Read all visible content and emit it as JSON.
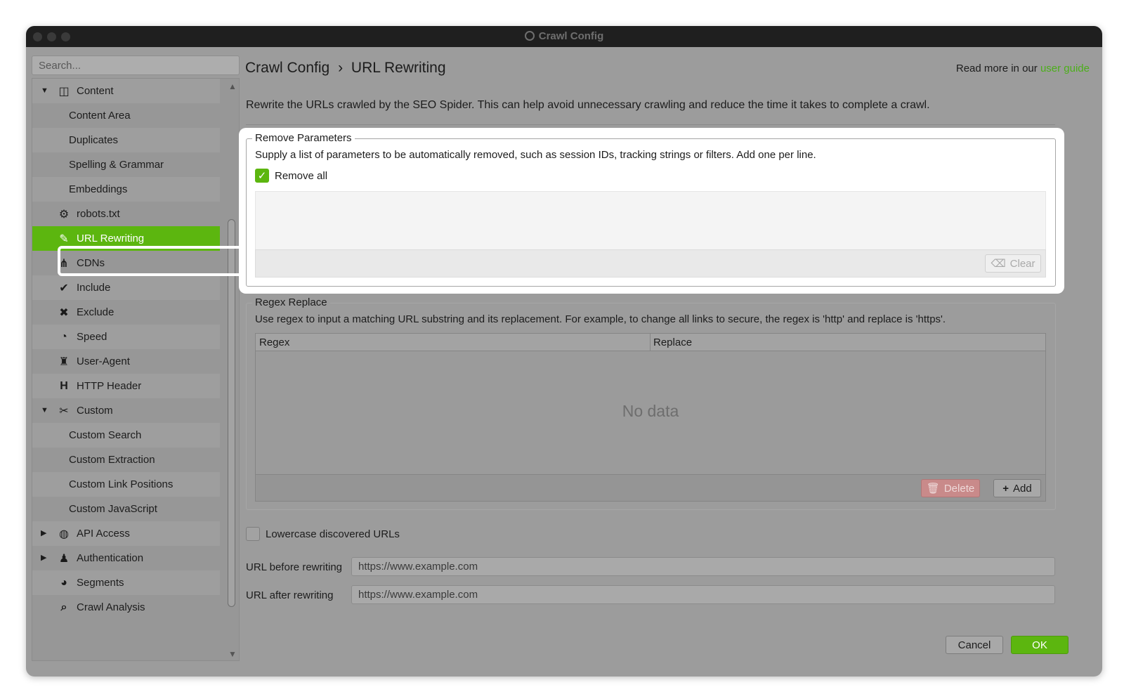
{
  "window": {
    "title": "Crawl Config"
  },
  "sidebar": {
    "search_placeholder": "Search...",
    "items": [
      {
        "label": "Content",
        "icon": "columns-icon",
        "level": 1,
        "arrow": "▼"
      },
      {
        "label": "Content Area",
        "level": 2
      },
      {
        "label": "Duplicates",
        "level": 2
      },
      {
        "label": "Spelling & Grammar",
        "level": 2
      },
      {
        "label": "Embeddings",
        "level": 2
      },
      {
        "label": "robots.txt",
        "icon": "robot-icon",
        "level": 1
      },
      {
        "label": "URL Rewriting",
        "icon": "edit-icon",
        "level": 1,
        "selected": true
      },
      {
        "label": "CDNs",
        "icon": "network-icon",
        "level": 1
      },
      {
        "label": "Include",
        "icon": "check-circle-icon",
        "level": 1
      },
      {
        "label": "Exclude",
        "icon": "x-circle-icon",
        "level": 1
      },
      {
        "label": "Speed",
        "icon": "gauge-icon",
        "level": 1
      },
      {
        "label": "User-Agent",
        "icon": "user-secret-icon",
        "level": 1
      },
      {
        "label": "HTTP Header",
        "icon": "heading-icon",
        "level": 1
      },
      {
        "label": "Custom",
        "icon": "tools-icon",
        "level": 1,
        "arrow": "▼"
      },
      {
        "label": "Custom Search",
        "level": 2
      },
      {
        "label": "Custom Extraction",
        "level": 2
      },
      {
        "label": "Custom Link Positions",
        "level": 2
      },
      {
        "label": "Custom JavaScript",
        "level": 2
      },
      {
        "label": "API Access",
        "icon": "globe-icon",
        "level": 1,
        "arrow": "▶"
      },
      {
        "label": "Authentication",
        "icon": "user-lock-icon",
        "level": 1,
        "arrow": "▶"
      },
      {
        "label": "Segments",
        "icon": "pie-chart-icon",
        "level": 1
      },
      {
        "label": "Crawl Analysis",
        "icon": "search-icon",
        "level": 1
      }
    ]
  },
  "main": {
    "breadcrumb_root": "Crawl Config",
    "breadcrumb_sep": "›",
    "breadcrumb_current": "URL Rewriting",
    "read_more_prefix": "Read more in our",
    "read_more_link": "user guide",
    "description": "Rewrite the URLs crawled by the SEO Spider. This can help avoid unnecessary crawling and reduce the time it takes to complete a crawl.",
    "remove_parameters": {
      "title": "Remove Parameters",
      "description": "Supply a list of parameters to be automatically removed, such as session IDs, tracking strings or filters. Add one per line.",
      "remove_all_label": "Remove all",
      "remove_all_checked": true,
      "clear_label": "Clear"
    },
    "regex_replace": {
      "title": "Regex Replace",
      "description": "Use regex to input a matching URL substring and its replacement. For example, to change all links to secure, the regex is 'http' and replace is 'https'.",
      "columns": [
        "Regex",
        "Replace"
      ],
      "empty_text": "No data",
      "delete_label": "Delete",
      "add_label": "Add"
    },
    "lowercase_label": "Lowercase discovered URLs",
    "lowercase_checked": false,
    "url_before_label": "URL before rewriting",
    "url_before_value": "https://www.example.com",
    "url_after_label": "URL after rewriting",
    "url_after_value": "https://www.example.com"
  },
  "footer": {
    "cancel_label": "Cancel",
    "ok_label": "OK"
  },
  "colors": {
    "accent": "#5cb60f",
    "link": "#4caf1a",
    "delete": "#c98a8a"
  }
}
